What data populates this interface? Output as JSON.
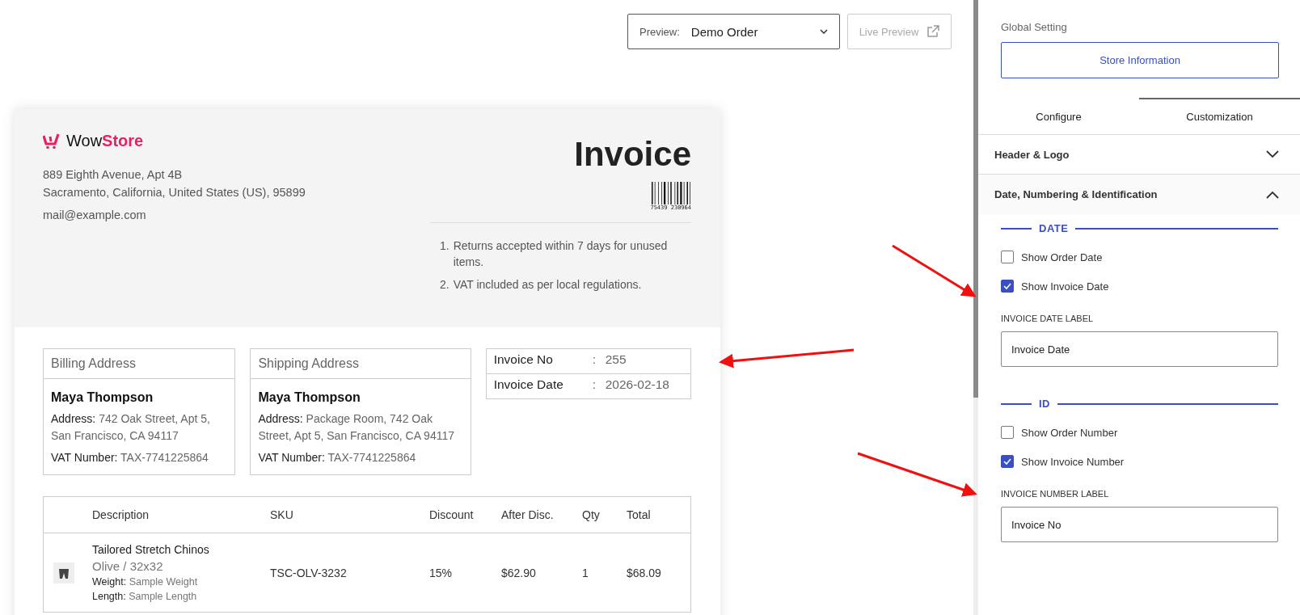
{
  "toolbar": {
    "preview_label": "Preview:",
    "preview_value": "Demo Order",
    "live_preview": "Live Preview"
  },
  "invoice": {
    "logo": {
      "prefix": "Wow",
      "accent": "Store"
    },
    "address_lines": [
      "889 Eighth Avenue, Apt 4B",
      "Sacramento, California, United States (US), 95899"
    ],
    "email": "mail@example.com",
    "title": "Invoice",
    "barcode_number": "75439 230964",
    "notes": [
      {
        "number": "1.",
        "text": "Returns accepted within 7 days for unused items."
      },
      {
        "number": "2.",
        "text": "VAT included as per local regulations."
      }
    ],
    "addresses": [
      {
        "title": "Billing Address",
        "name": "Maya Thompson",
        "address_label": "Address:",
        "address": "742 Oak Street, Apt 5, San Francisco, CA 94117",
        "vat_label": "VAT Number:",
        "vat": "TAX-7741225864"
      },
      {
        "title": "Shipping Address",
        "name": "Maya Thompson",
        "address_label": "Address:",
        "address": "Package Room, 742 Oak Street, Apt 5, San Francisco, CA 94117",
        "vat_label": "VAT Number:",
        "vat": "TAX-7741225864"
      }
    ],
    "meta": [
      {
        "label": "Invoice No",
        "separator": ":",
        "value": "255"
      },
      {
        "label": "Invoice Date",
        "separator": ":",
        "value": "2026-02-18"
      }
    ],
    "table": {
      "columns": [
        "Description",
        "SKU",
        "Discount",
        "After Disc.",
        "Qty",
        "Total"
      ],
      "rows": [
        {
          "name": "Tailored Stretch Chinos",
          "variant": "Olive / 32x32",
          "weight_label": "Weight:",
          "weight": "Sample Weight",
          "length_label": "Length:",
          "length": "Sample Length",
          "sku": "TSC-OLV-3232",
          "discount": "15%",
          "after_discount": "$62.90",
          "qty": "1",
          "total": "$68.09"
        }
      ]
    }
  },
  "panel": {
    "global_setting": "Global Setting",
    "store_button": "Store Information",
    "tabs": [
      {
        "label": "Configure",
        "selected": false
      },
      {
        "label": "Customization",
        "selected": true
      }
    ],
    "sections": [
      {
        "title": "Header & Logo",
        "expanded": false
      },
      {
        "title": "Date, Numbering & Identification",
        "expanded": true
      }
    ],
    "groups": [
      {
        "heading": "DATE",
        "checkboxes": [
          {
            "label": "Show Order Date",
            "checked": false
          },
          {
            "label": "Show Invoice Date",
            "checked": true
          }
        ],
        "field_label": "INVOICE DATE LABEL",
        "field_value": "Invoice Date"
      },
      {
        "heading": "ID",
        "checkboxes": [
          {
            "label": "Show Order Number",
            "checked": false
          },
          {
            "label": "Show Invoice Number",
            "checked": true
          }
        ],
        "field_label": "INVOICE NUMBER LABEL",
        "field_value": "Invoice No"
      }
    ]
  }
}
